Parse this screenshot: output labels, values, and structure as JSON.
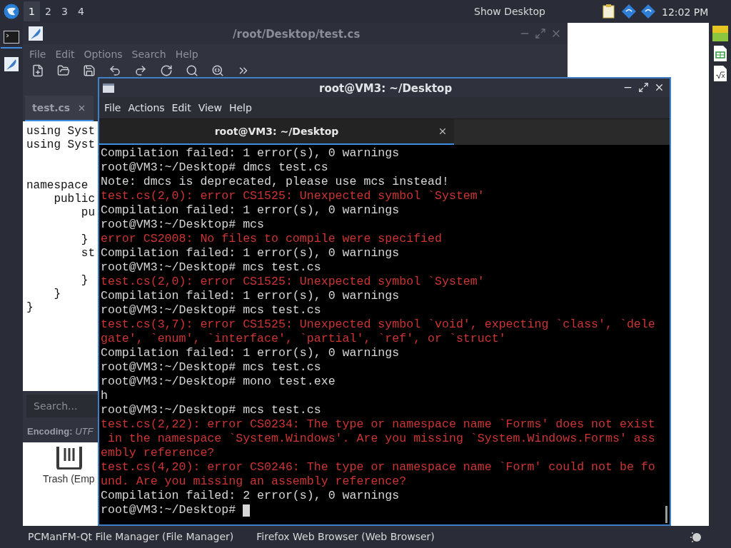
{
  "top_panel": {
    "workspaces": [
      {
        "label": "1",
        "selected": true
      },
      {
        "label": "2",
        "selected": false
      },
      {
        "label": "3",
        "selected": false
      },
      {
        "label": "4",
        "selected": false
      }
    ],
    "show_desktop": "Show Desktop",
    "clock": "12:02 PM"
  },
  "dock": {
    "items": [
      {
        "kind": "terminal",
        "selected": true
      },
      {
        "kind": "editor",
        "selected": false
      }
    ]
  },
  "editor": {
    "title": "/root/Desktop/test.cs",
    "menu": [
      "File",
      "Edit",
      "Options",
      "Search",
      "Help"
    ],
    "tab": {
      "label": "test.cs",
      "selected": true
    },
    "code": "using Syst\nusing Syst\n\n\nnamespace\n    public\n        pu\n\n        }\n        st\n\n        }\n    }\n}",
    "search": {
      "placeholder": "Search..."
    },
    "encoding": "**Encoding:** *UTF*"
  },
  "desktop_icons": [
    {
      "label": "Trash (Emp"
    }
  ],
  "terminal": {
    "title": "root@VM3: ~/Desktop",
    "menu": [
      "File",
      "Actions",
      "Edit",
      "View",
      "Help"
    ],
    "tab": {
      "label": "root@VM3: ~/Desktop",
      "selected": true
    },
    "lines": [
      {
        "kind": "output",
        "text": "Compilation failed: 1 error(s), 0 warnings"
      },
      {
        "kind": "output",
        "text": "root@VM3:~/Desktop# dmcs test.cs"
      },
      {
        "kind": "output",
        "text": "Note: dmcs is deprecated, please use mcs instead!"
      },
      {
        "kind": "error",
        "text": "test.cs(2,0): error CS1525: Unexpected symbol `System'"
      },
      {
        "kind": "output",
        "text": "Compilation failed: 1 error(s), 0 warnings"
      },
      {
        "kind": "output",
        "text": "root@VM3:~/Desktop# mcs"
      },
      {
        "kind": "error",
        "text": "error CS2008: No files to compile were specified"
      },
      {
        "kind": "output",
        "text": "Compilation failed: 1 error(s), 0 warnings"
      },
      {
        "kind": "output",
        "text": "root@VM3:~/Desktop# mcs test.cs"
      },
      {
        "kind": "error",
        "text": "test.cs(2,0): error CS1525: Unexpected symbol `System'"
      },
      {
        "kind": "output",
        "text": "Compilation failed: 1 error(s), 0 warnings"
      },
      {
        "kind": "output",
        "text": "root@VM3:~/Desktop# mcs test.cs"
      },
      {
        "kind": "error",
        "text": "test.cs(3,7): error CS1525: Unexpected symbol `void', expecting `class', `dele"
      },
      {
        "kind": "error",
        "text": "gate', `enum', `interface', `partial', `ref', or `struct'"
      },
      {
        "kind": "output",
        "text": "Compilation failed: 1 error(s), 0 warnings"
      },
      {
        "kind": "output",
        "text": "root@VM3:~/Desktop# mcs test.cs"
      },
      {
        "kind": "output",
        "text": "root@VM3:~/Desktop# mono test.exe"
      },
      {
        "kind": "output",
        "text": "h"
      },
      {
        "kind": "output",
        "text": "root@VM3:~/Desktop# mcs test.cs"
      },
      {
        "kind": "error",
        "text": "test.cs(2,22): error CS0234: The type or namespace name `Forms' does not exist"
      },
      {
        "kind": "error",
        "text": " in the namespace `System.Windows'. Are you missing `System.Windows.Forms' ass"
      },
      {
        "kind": "error",
        "text": "embly reference?"
      },
      {
        "kind": "error",
        "text": "test.cs(4,20): error CS0246: The type or namespace name `Form' could not be fo"
      },
      {
        "kind": "error",
        "text": "und. Are you missing an assembly reference?"
      },
      {
        "kind": "output",
        "text": "Compilation failed: 2 error(s), 0 warnings"
      },
      {
        "kind": "output",
        "text": "root@VM3:~/Desktop#",
        "cursor": true
      }
    ]
  },
  "taskbar": {
    "tasks": [
      "PCManFM-Qt File Manager (File Manager)",
      "Firefox Web Browser (Web Browser)"
    ]
  }
}
